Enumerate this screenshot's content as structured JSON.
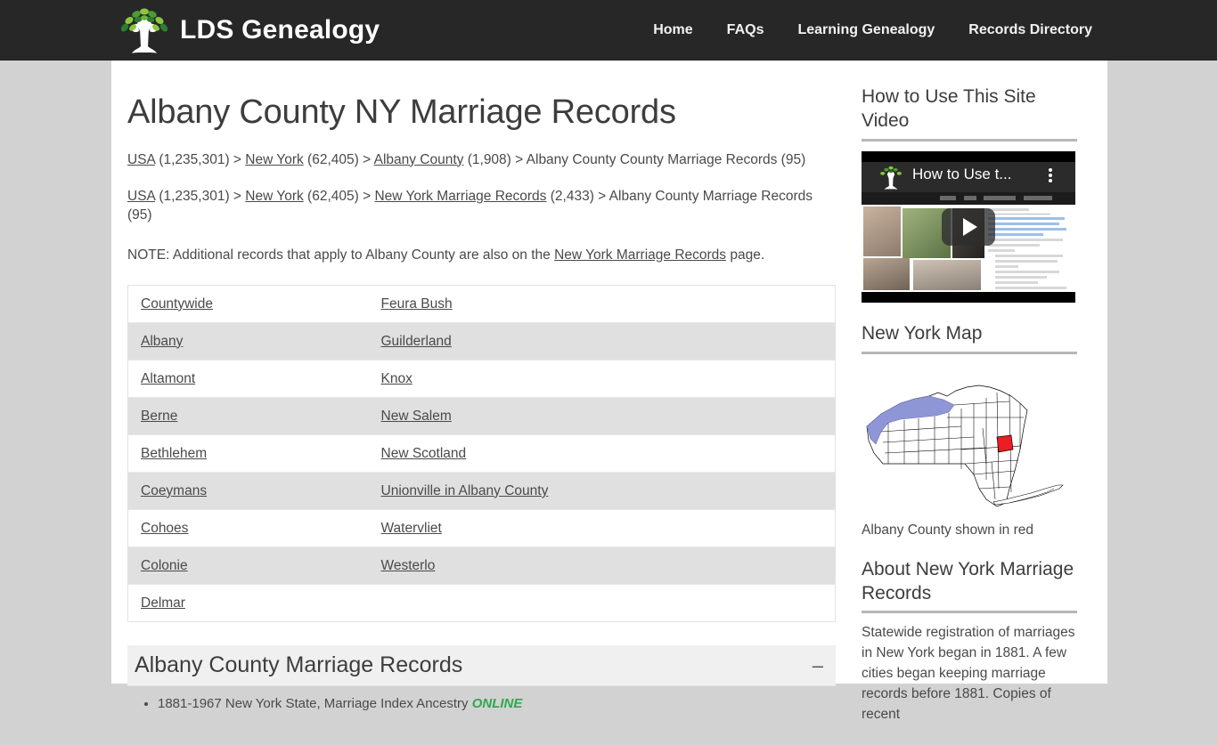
{
  "site": {
    "logo_text": "LDS Genealogy",
    "nav": [
      {
        "label": "Home"
      },
      {
        "label": "FAQs"
      },
      {
        "label": "Learning Genealogy"
      },
      {
        "label": "Records Directory"
      }
    ]
  },
  "main": {
    "title": "Albany County NY Marriage Records",
    "breadcrumb1": {
      "l1": "USA",
      "c1": " (1,235,301) > ",
      "l2": "New York",
      "c2": " (62,405) > ",
      "l3": "Albany County",
      "c3": " (1,908) > ",
      "tail": "Albany County County Marriage Records (95)"
    },
    "breadcrumb2": {
      "l1": "USA",
      "c1": " (1,235,301) > ",
      "l2": "New York",
      "c2": " (62,405) > ",
      "l3": "New York Marriage Records",
      "c3": " (2,433) > ",
      "tail": "Albany County Marriage Records (95)"
    },
    "note_pre": "NOTE: Additional records that apply to Albany County are also on the ",
    "note_link": "New York Marriage Records",
    "note_post": " page."
  },
  "places": [
    {
      "left": "Countywide",
      "right": "Feura Bush"
    },
    {
      "left": "Albany",
      "right": "Guilderland"
    },
    {
      "left": "Altamont",
      "right": "Knox"
    },
    {
      "left": "Berne",
      "right": "New Salem"
    },
    {
      "left": "Bethlehem",
      "right": "New Scotland"
    },
    {
      "left": "Coeymans",
      "right": "Unionville in Albany County"
    },
    {
      "left": "Cohoes",
      "right": "Watervliet"
    },
    {
      "left": "Colonie",
      "right": "Westerlo"
    },
    {
      "left": "Delmar",
      "right": ""
    }
  ],
  "records_panel": {
    "title": "Albany County Marriage Records",
    "toggle": "–",
    "items": [
      {
        "text": "1881-1967 New York State, Marriage Index Ancestry ",
        "badge": "ONLINE"
      }
    ]
  },
  "sidebar": {
    "video": {
      "heading": "How to Use This Site Video",
      "overlay_title": "How to Use t...",
      "play_icon": "play-icon"
    },
    "map": {
      "heading": "New York Map",
      "caption": "Albany County shown in red",
      "highlight_color": "#ee1c25",
      "water_color": "#8f96d6"
    },
    "about": {
      "heading": "About New York Marriage Records",
      "text": "Statewide registration of marriages in New York began in 1881. A few cities began keeping marriage records before 1881. Copies of recent"
    }
  }
}
